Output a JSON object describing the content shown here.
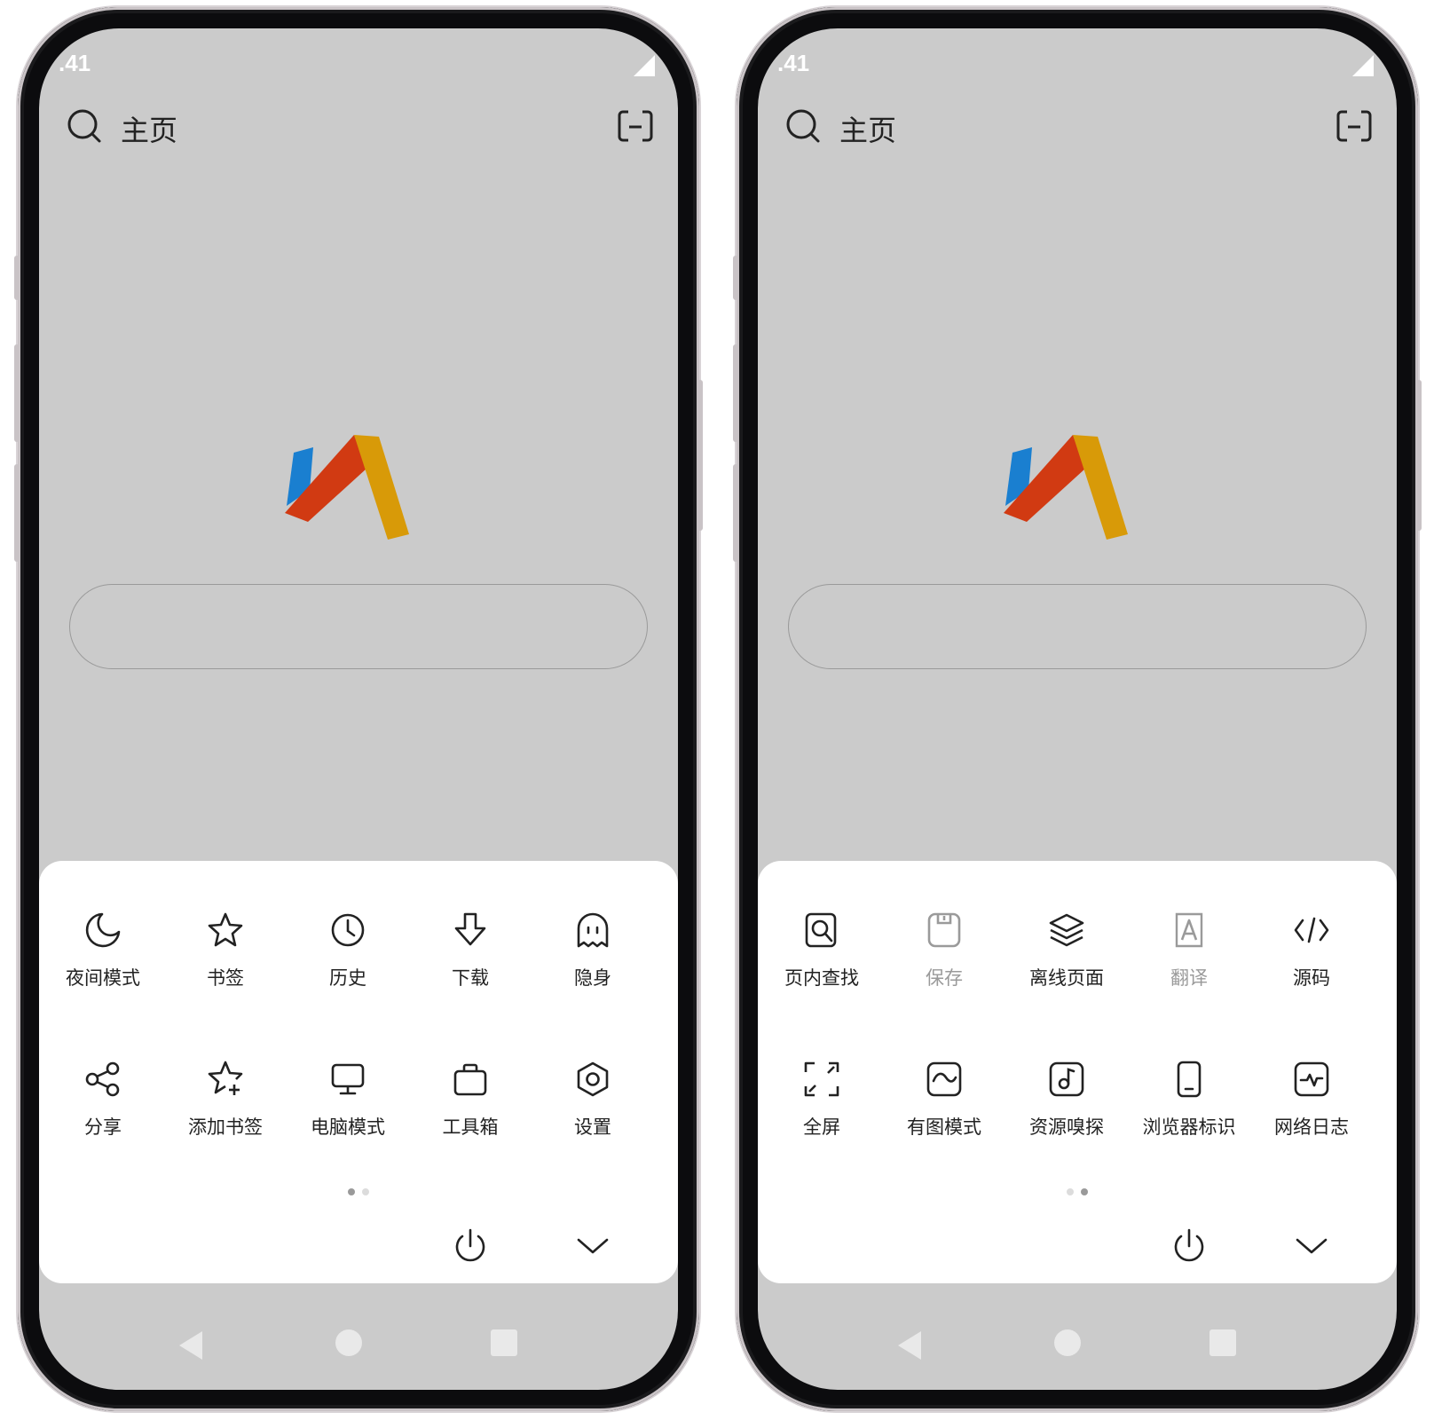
{
  "colors": {
    "screen_bg": "#cbcbcb",
    "sheet_bg": "#ffffff",
    "icon": "#222222",
    "disabled": "#9a9a9a",
    "logo_blue": "#1a7fd0",
    "logo_red": "#d13a12",
    "logo_yellow": "#d89a08"
  },
  "phones": [
    {
      "status_time": ".41",
      "header": {
        "search_icon": "search-icon",
        "title": "主页",
        "tabs_icon": "tab-switcher-icon"
      },
      "menu": {
        "items": [
          {
            "label": "夜间模式",
            "icon": "moon-icon",
            "enabled": true
          },
          {
            "label": "书签",
            "icon": "star-icon",
            "enabled": true
          },
          {
            "label": "历史",
            "icon": "clock-icon",
            "enabled": true
          },
          {
            "label": "下载",
            "icon": "download-icon",
            "enabled": true
          },
          {
            "label": "隐身",
            "icon": "ghost-icon",
            "enabled": true
          },
          {
            "label": "分享",
            "icon": "share-icon",
            "enabled": true
          },
          {
            "label": "添加书签",
            "icon": "star-plus-icon",
            "enabled": true
          },
          {
            "label": "电脑模式",
            "icon": "monitor-icon",
            "enabled": true
          },
          {
            "label": "工具箱",
            "icon": "toolbox-icon",
            "enabled": true
          },
          {
            "label": "设置",
            "icon": "settings-icon",
            "enabled": true
          }
        ],
        "active_page": 1,
        "page_count": 2
      }
    },
    {
      "status_time": ".41",
      "header": {
        "search_icon": "search-icon",
        "title": "主页",
        "tabs_icon": "tab-switcher-icon"
      },
      "menu": {
        "items": [
          {
            "label": "页内查找",
            "icon": "find-in-page-icon",
            "enabled": true
          },
          {
            "label": "保存",
            "icon": "save-icon",
            "enabled": false
          },
          {
            "label": "离线页面",
            "icon": "layers-icon",
            "enabled": true
          },
          {
            "label": "翻译",
            "icon": "translate-icon",
            "enabled": false
          },
          {
            "label": "源码",
            "icon": "code-icon",
            "enabled": true
          },
          {
            "label": "全屏",
            "icon": "fullscreen-icon",
            "enabled": true
          },
          {
            "label": "有图模式",
            "icon": "image-icon",
            "enabled": true
          },
          {
            "label": "资源嗅探",
            "icon": "music-file-icon",
            "enabled": true
          },
          {
            "label": "浏览器标识",
            "icon": "phone-icon",
            "enabled": true
          },
          {
            "label": "网络日志",
            "icon": "activity-icon",
            "enabled": true
          }
        ],
        "active_page": 2,
        "page_count": 2
      }
    }
  ]
}
